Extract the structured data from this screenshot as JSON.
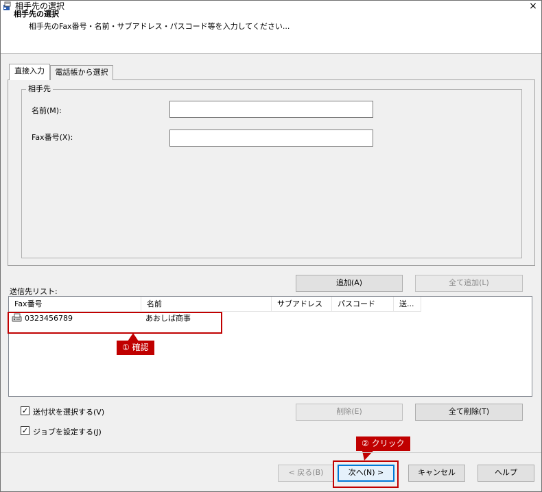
{
  "window": {
    "title": "相手先の選択",
    "close_glyph": "×"
  },
  "header": {
    "title": "相手先の選択",
    "subtitle": "相手先のFax番号・名前・サブアドレス・パスコード等を入力してください..."
  },
  "tabs": [
    {
      "label": "直接入力",
      "active": true
    },
    {
      "label": "電話帳から選択",
      "active": false
    }
  ],
  "recipient_group": {
    "legend": "相手先",
    "name_label": "名前(M):",
    "name_value": "",
    "fax_label": "Fax番号(X):",
    "fax_value": ""
  },
  "buttons": {
    "add": "追加(A)",
    "add_all": "全て追加(L)",
    "delete": "削除(E)",
    "delete_all": "全て削除(T)",
    "back": "< 戻る(B)",
    "next": "次へ(N) >",
    "cancel": "キャンセル",
    "help": "ヘルプ"
  },
  "send_list": {
    "label": "送信先リスト:",
    "columns": [
      "Fax番号",
      "名前",
      "サブアドレス",
      "パスコード",
      "送..."
    ],
    "rows": [
      {
        "fax": "0323456789",
        "name": "あおしば商事",
        "subaddress": "",
        "passcode": "",
        "send": ""
      }
    ]
  },
  "options": {
    "cover_sheet_label": "送付状を選択する(V)",
    "cover_sheet_checked": true,
    "job_label": "ジョブを設定する(J)",
    "job_checked": true
  },
  "annotations": {
    "confirm_label": "① 確認",
    "click_label": "② クリック"
  },
  "colors": {
    "annotation_red": "#c00000",
    "focus_blue": "#0078d7"
  },
  "icons": {
    "app": "fax-app-icon",
    "row": "fax-machine-icon"
  }
}
